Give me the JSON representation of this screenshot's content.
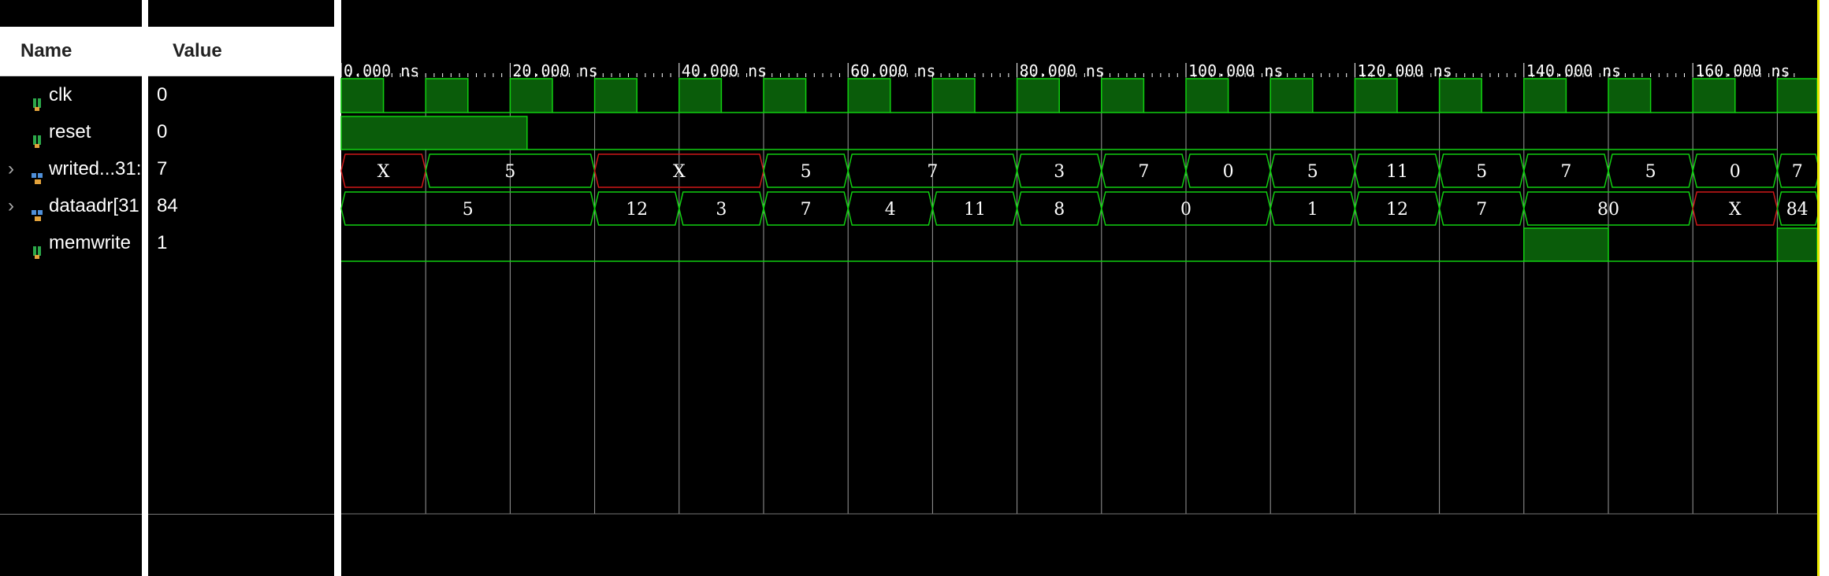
{
  "columns": {
    "name": "Name",
    "value": "Value"
  },
  "signals": [
    {
      "name": "clk",
      "value": "0",
      "kind": "bit",
      "icon": "bit-signal-icon"
    },
    {
      "name": "reset",
      "value": "0",
      "kind": "bit",
      "icon": "bit-signal-icon"
    },
    {
      "name": "writed...31:",
      "value": "7",
      "kind": "bus",
      "icon": "bus-signal-icon",
      "expandable": true
    },
    {
      "name": "dataadr[31",
      "value": "84",
      "kind": "bus",
      "icon": "bus-signal-icon",
      "expandable": true
    },
    {
      "name": "memwrite",
      "value": "1",
      "kind": "bit",
      "icon": "bit-signal-icon"
    }
  ],
  "timeline": {
    "unit": "ns",
    "labels": [
      "0.000 ns",
      "20.000 ns",
      "40.000 ns",
      "60.000 ns",
      "80.000 ns",
      "100.000 ns",
      "120.000 ns",
      "140.000 ns",
      "160.000 ns"
    ],
    "label_times": [
      0,
      20,
      40,
      60,
      80,
      100,
      120,
      140,
      160
    ],
    "visible_end": 170
  },
  "waves": {
    "clk": {
      "period": 10,
      "high_first": 5
    },
    "reset": {
      "segments": [
        [
          0,
          22,
          1
        ],
        [
          22,
          170,
          0
        ]
      ]
    },
    "writedata": [
      {
        "t0": 0,
        "t1": 10,
        "v": "X",
        "undefined": true
      },
      {
        "t0": 10,
        "t1": 30,
        "v": "5"
      },
      {
        "t0": 30,
        "t1": 50,
        "v": "X",
        "undefined": true
      },
      {
        "t0": 50,
        "t1": 60,
        "v": "5"
      },
      {
        "t0": 60,
        "t1": 80,
        "v": "7"
      },
      {
        "t0": 80,
        "t1": 90,
        "v": "3"
      },
      {
        "t0": 90,
        "t1": 100,
        "v": "7"
      },
      {
        "t0": 100,
        "t1": 110,
        "v": "0"
      },
      {
        "t0": 110,
        "t1": 120,
        "v": "5"
      },
      {
        "t0": 120,
        "t1": 130,
        "v": "11"
      },
      {
        "t0": 130,
        "t1": 140,
        "v": "5"
      },
      {
        "t0": 140,
        "t1": 150,
        "v": "7"
      },
      {
        "t0": 150,
        "t1": 160,
        "v": "5"
      },
      {
        "t0": 160,
        "t1": 170,
        "v": "0"
      },
      {
        "t0": 170,
        "t1": 175,
        "v": "7"
      }
    ],
    "dataadr": [
      {
        "t0": 0,
        "t1": 30,
        "v": "5"
      },
      {
        "t0": 30,
        "t1": 40,
        "v": "12"
      },
      {
        "t0": 40,
        "t1": 50,
        "v": "3"
      },
      {
        "t0": 50,
        "t1": 60,
        "v": "7"
      },
      {
        "t0": 60,
        "t1": 70,
        "v": "4"
      },
      {
        "t0": 70,
        "t1": 80,
        "v": "11"
      },
      {
        "t0": 80,
        "t1": 90,
        "v": "8"
      },
      {
        "t0": 90,
        "t1": 110,
        "v": "0"
      },
      {
        "t0": 110,
        "t1": 120,
        "v": "1"
      },
      {
        "t0": 120,
        "t1": 130,
        "v": "12"
      },
      {
        "t0": 130,
        "t1": 140,
        "v": "7"
      },
      {
        "t0": 140,
        "t1": 160,
        "v": "80"
      },
      {
        "t0": 160,
        "t1": 170,
        "v": "X",
        "undefined": true
      },
      {
        "t0": 170,
        "t1": 175,
        "v": "84"
      }
    ],
    "memwrite": {
      "segments": [
        [
          0,
          140,
          0
        ],
        [
          140,
          150,
          1
        ],
        [
          150,
          170,
          0
        ],
        [
          170,
          175,
          1
        ]
      ]
    }
  },
  "colors": {
    "wave_line": "#10d010",
    "wave_fill": "#0a5c0a",
    "undefined_line": "#d01818",
    "grid": "#9a9a9a",
    "cursor": "#e8e800"
  }
}
